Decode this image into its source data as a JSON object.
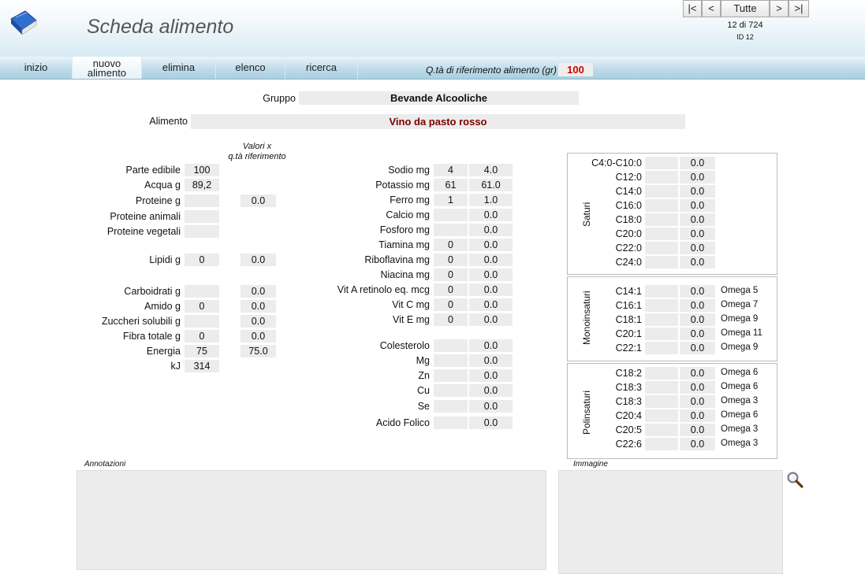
{
  "window": {
    "title": "Scheda alimento"
  },
  "nav": {
    "first": "|<",
    "prev": "<",
    "all": "Tutte",
    "next": ">",
    "last": ">|",
    "counter": "12 di 724",
    "record_id": "ID  12"
  },
  "menu": {
    "home": "inizio",
    "new_line1": "nuovo",
    "new_line2": "alimento",
    "delete": "elimina",
    "list": "elenco",
    "search": "ricerca"
  },
  "reference_qty": {
    "label": "Q.tà di riferimento alimento (gr)",
    "value": "100"
  },
  "food": {
    "group_label": "Gruppo",
    "group_value": "Bevande Alcooliche",
    "name_label": "Alimento",
    "name_value": "Vino da pasto rosso"
  },
  "col_header": {
    "line1": "Valori x",
    "line2": "q.tà riferimento"
  },
  "left_rows": [
    {
      "label": "Parte edibile",
      "value": "100",
      "ref": ""
    },
    {
      "label": "Acqua g",
      "value": "89,2",
      "ref": ""
    },
    {
      "label": "Proteine g",
      "value": "",
      "ref": "0.0"
    },
    {
      "label": "Proteine animali",
      "value": "",
      "ref": ""
    },
    {
      "label": "Proteine vegetali",
      "value": "",
      "ref": ""
    },
    {
      "label": "Lipidi g",
      "value": "0",
      "ref": "0.0"
    },
    {
      "label": "Carboidrati g",
      "value": "",
      "ref": "0.0"
    },
    {
      "label": "Amido g",
      "value": "0",
      "ref": "0.0"
    },
    {
      "label": "Zuccheri solubili g",
      "value": "",
      "ref": "0.0"
    },
    {
      "label": "Fibra totale g",
      "value": "0",
      "ref": "0.0"
    },
    {
      "label": "Energia",
      "value": "75",
      "ref": "75.0"
    },
    {
      "label": "kJ",
      "value": "314",
      "ref": ""
    }
  ],
  "mid_rows": [
    {
      "label": "Sodio mg",
      "value": "4",
      "ref": "4.0"
    },
    {
      "label": "Potassio mg",
      "value": "61",
      "ref": "61.0"
    },
    {
      "label": "Ferro mg",
      "value": "1",
      "ref": "1.0"
    },
    {
      "label": "Calcio mg",
      "value": "",
      "ref": "0.0"
    },
    {
      "label": "Fosforo mg",
      "value": "",
      "ref": "0.0"
    },
    {
      "label": "Tiamina mg",
      "value": "0",
      "ref": "0.0"
    },
    {
      "label": "Riboflavina mg",
      "value": "0",
      "ref": "0.0"
    },
    {
      "label": "Niacina mg",
      "value": "0",
      "ref": "0.0"
    },
    {
      "label": "Vit A retinolo eq. mcg",
      "value": "0",
      "ref": "0.0"
    },
    {
      "label": "Vit C mg",
      "value": "0",
      "ref": "0.0"
    },
    {
      "label": "Vit E mg",
      "value": "0",
      "ref": "0.0"
    },
    {
      "label": "Colesterolo",
      "value": "",
      "ref": "0.0"
    },
    {
      "label": "Mg",
      "value": "",
      "ref": "0.0"
    },
    {
      "label": "Zn",
      "value": "",
      "ref": "0.0"
    },
    {
      "label": "Cu",
      "value": "",
      "ref": "0.0"
    },
    {
      "label": "Se",
      "value": "",
      "ref": "0.0"
    },
    {
      "label": "Acido Folico",
      "value": "",
      "ref": "0.0"
    }
  ],
  "fats": {
    "saturated": {
      "title": "Saturi",
      "rows": [
        {
          "label": "C4:0-C10:0",
          "value": "",
          "ref": "0.0",
          "omega": ""
        },
        {
          "label": "C12:0",
          "value": "",
          "ref": "0.0",
          "omega": ""
        },
        {
          "label": "C14:0",
          "value": "",
          "ref": "0.0",
          "omega": ""
        },
        {
          "label": "C16:0",
          "value": "",
          "ref": "0.0",
          "omega": ""
        },
        {
          "label": "C18:0",
          "value": "",
          "ref": "0.0",
          "omega": ""
        },
        {
          "label": "C20:0",
          "value": "",
          "ref": "0.0",
          "omega": ""
        },
        {
          "label": "C22:0",
          "value": "",
          "ref": "0.0",
          "omega": ""
        },
        {
          "label": "C24:0",
          "value": "",
          "ref": "0.0",
          "omega": ""
        }
      ]
    },
    "mono": {
      "title": "Monoinsaturi",
      "rows": [
        {
          "label": "C14:1",
          "value": "",
          "ref": "0.0",
          "omega": "Omega 5"
        },
        {
          "label": "C16:1",
          "value": "",
          "ref": "0.0",
          "omega": "Omega 7"
        },
        {
          "label": "C18:1",
          "value": "",
          "ref": "0.0",
          "omega": "Omega 9"
        },
        {
          "label": "C20:1",
          "value": "",
          "ref": "0.0",
          "omega": "Omega 11"
        },
        {
          "label": "C22:1",
          "value": "",
          "ref": "0.0",
          "omega": "Omega 9"
        }
      ]
    },
    "poly": {
      "title": "Polinsaturi",
      "rows": [
        {
          "label": "C18:2",
          "value": "",
          "ref": "0.0",
          "omega": "Omega 6"
        },
        {
          "label": "C18:3",
          "value": "",
          "ref": "0.0",
          "omega": "Omega 6"
        },
        {
          "label": "C18:3",
          "value": "",
          "ref": "0.0",
          "omega": "Omega 3"
        },
        {
          "label": "C20:4",
          "value": "",
          "ref": "0.0",
          "omega": "Omega 6"
        },
        {
          "label": "C20:5",
          "value": "",
          "ref": "0.0",
          "omega": "Omega 3"
        },
        {
          "label": "C22:6",
          "value": "",
          "ref": "0.0",
          "omega": "Omega 3"
        }
      ]
    }
  },
  "notes": {
    "label": "Annotazioni"
  },
  "image": {
    "label": "Immagine",
    "zoom_icon": "magnifier-icon"
  },
  "colors": {
    "accent_red": "#d00000",
    "food_name": "#7a0000",
    "field_bg": "#ececec"
  }
}
